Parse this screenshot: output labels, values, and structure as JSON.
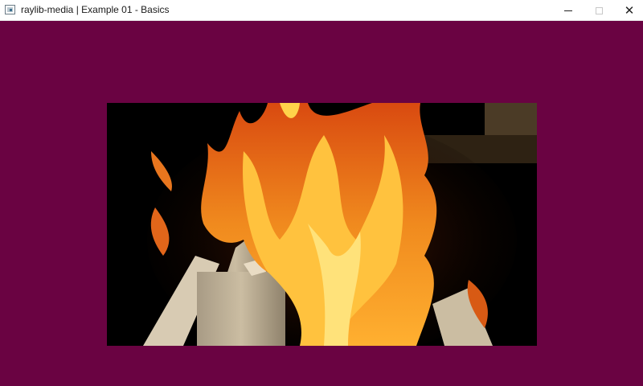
{
  "window": {
    "title": "raylib-media | Example 01 - Basics",
    "background_color": "#6a0342",
    "icon": "app-window-icon",
    "controls": {
      "minimize": {
        "icon": "minimize-icon"
      },
      "maximize": {
        "icon": "maximize-icon",
        "enabled": false
      },
      "close": {
        "icon": "close-icon",
        "glyph": "✕"
      }
    }
  },
  "video": {
    "content": "video-frame",
    "colors": {
      "flame_outer": "#d94a10",
      "flame_mid": "#f5901e",
      "flame_core": "#ffd24a",
      "wood": "#c9b79a",
      "background": "#000000"
    }
  }
}
